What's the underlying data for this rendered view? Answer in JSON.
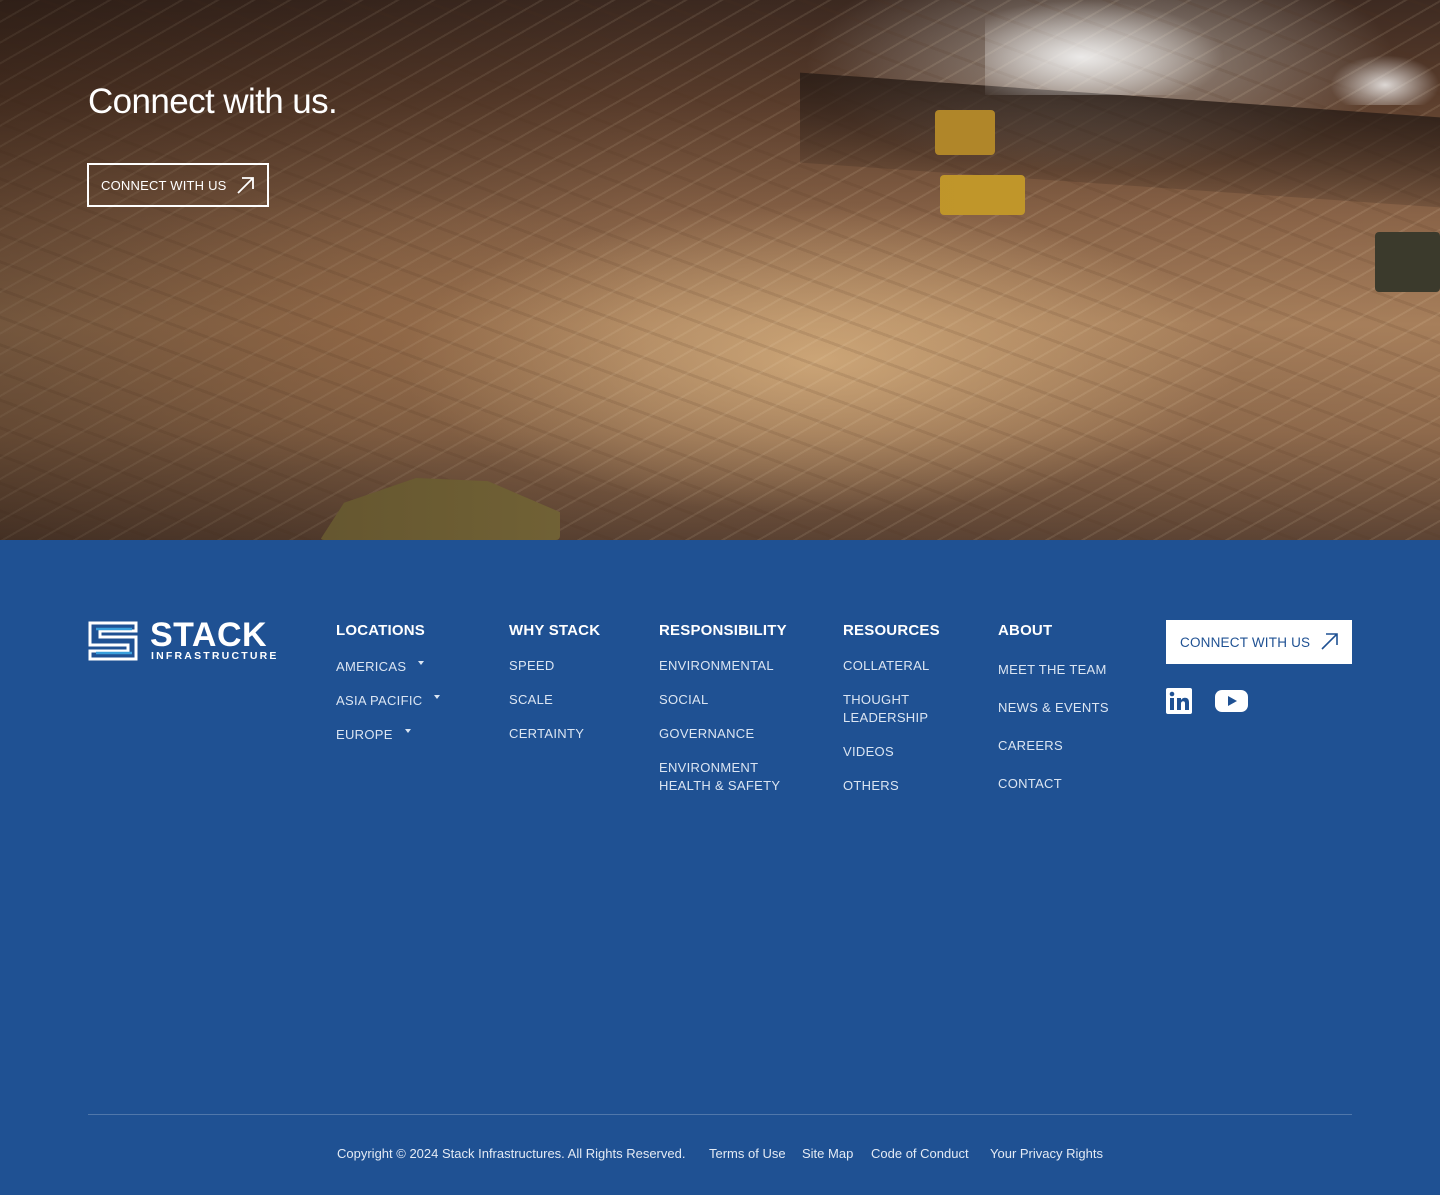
{
  "hero": {
    "title": "Connect with us.",
    "button_label": "CONNECT WITH US"
  },
  "logo": {
    "word": "STACK",
    "sub": "INFRASTRUCTURE"
  },
  "footer": {
    "columns": [
      {
        "heading": "LOCATIONS",
        "links": [
          "AMERICAS",
          "ASIA PACIFIC",
          "EUROPE"
        ]
      },
      {
        "heading": "WHY STACK",
        "links": [
          "SPEED",
          "SCALE",
          "CERTAINTY"
        ]
      },
      {
        "heading": "RESPONSIBILITY",
        "links": [
          "ENVIRONMENTAL",
          "SOCIAL",
          "GOVERNANCE",
          "ENVIRONMENT",
          "HEALTH & SAFETY"
        ]
      },
      {
        "heading": "RESOURCES",
        "links": [
          "COLLATERAL",
          "THOUGHT",
          "LEADERSHIP",
          "VIDEOS",
          "OTHERS"
        ]
      },
      {
        "heading": "ABOUT",
        "links": [
          "MEET THE TEAM",
          "NEWS & EVENTS",
          "CAREERS",
          "CONTACT"
        ]
      }
    ],
    "cta_label": "CONNECT WITH US",
    "social": [
      "linkedin-icon",
      "youtube-icon"
    ],
    "colors": {
      "background": "#1f5193",
      "link": "#dbe5f2"
    }
  },
  "bottom_bar": {
    "copyright": "Copyright © 2024 Stack Infrastructures. All Rights Reserved.",
    "links": [
      "Terms of Use",
      "Site Map",
      "Code of Conduct",
      "Your Privacy Rights"
    ]
  }
}
